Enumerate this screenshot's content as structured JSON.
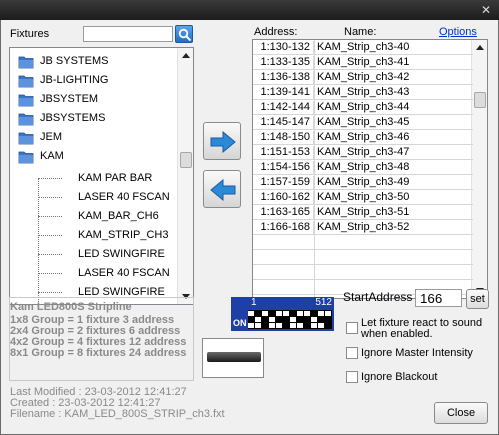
{
  "window": {
    "close_glyph": "✕"
  },
  "fixtures_label": "Fixtures",
  "search": {
    "value": "",
    "icon": "search-icon"
  },
  "tree": {
    "folders": [
      "JB SYSTEMS",
      "JB-LIGHTING",
      "JBSYSTEM",
      "JBSYSTEMS",
      "JEM",
      "KAM"
    ],
    "leaves": [
      "KAM PAR BAR",
      "LASER 40 FSCAN",
      "KAM_BAR_CH6",
      "KAM_STRIP_CH3",
      "LED SWINGFIRE",
      "LASER 40 FSCAN",
      "LED SWINGFIRE"
    ]
  },
  "info": {
    "title": "Kam LED800S Stripline",
    "lines": [
      "1x8 Group = 1 fixture    3 address",
      "2x4 Group = 2 fixtures  6 address",
      "4x2 Group = 4 fixtures 12 address",
      "8x1 Group = 8 fixtures 24 address"
    ]
  },
  "meta": {
    "modified": "Last Modified : 23-03-2012 12:41:27",
    "created": "Created : 23-03-2012 12:41:27",
    "filename": "Filename : KAM_LED_800S_STRIP_ch3.fxt"
  },
  "arrows": {
    "add": "arrow-right-icon",
    "remove": "arrow-left-icon"
  },
  "table": {
    "address_header": "Address:",
    "name_header": "Name:",
    "options_link": "Options",
    "rows": [
      {
        "address": "1:130-132",
        "name": "KAM_Strip_ch3-40"
      },
      {
        "address": "1:133-135",
        "name": "KAM_Strip_ch3-41"
      },
      {
        "address": "1:136-138",
        "name": "KAM_Strip_ch3-42"
      },
      {
        "address": "1:139-141",
        "name": "KAM_Strip_ch3-43"
      },
      {
        "address": "1:142-144",
        "name": "KAM_Strip_ch3-44"
      },
      {
        "address": "1:145-147",
        "name": "KAM_Strip_ch3-45"
      },
      {
        "address": "1:148-150",
        "name": "KAM_Strip_ch3-46"
      },
      {
        "address": "1:151-153",
        "name": "KAM_Strip_ch3-47"
      },
      {
        "address": "1:154-156",
        "name": "KAM_Strip_ch3-48"
      },
      {
        "address": "1:157-159",
        "name": "KAM_Strip_ch3-49"
      },
      {
        "address": "1:160-162",
        "name": "KAM_Strip_ch3-50"
      },
      {
        "address": "1:163-165",
        "name": "KAM_Strip_ch3-51"
      },
      {
        "address": "1:166-168",
        "name": "KAM_Strip_ch3-52"
      }
    ]
  },
  "dmx": {
    "start": "1",
    "end": "512",
    "on": "ON"
  },
  "start_address": {
    "label": "StartAddress :",
    "value": "166",
    "set_label": "set"
  },
  "options": {
    "sound": "Let fixture react to sound when enabled.",
    "intensity": "Ignore Master Intensity",
    "blackout": "Ignore Blackout"
  },
  "close_label": "Close",
  "colors": {
    "dmx_blue": "#1e3fa6",
    "link": "#0033cc",
    "arrow_blue": "#2b8ad8"
  }
}
